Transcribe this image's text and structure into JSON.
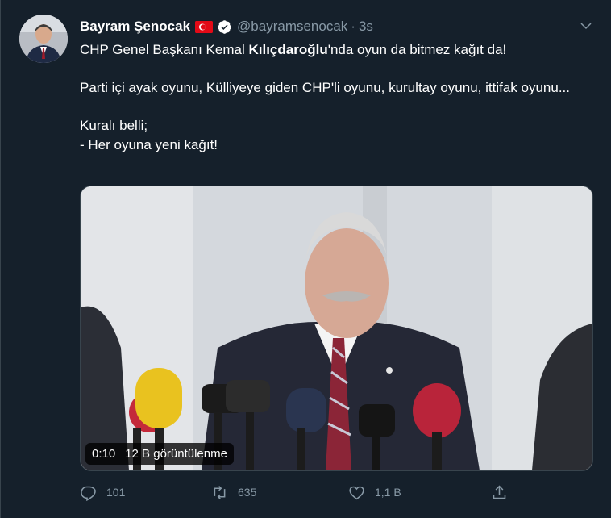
{
  "author": {
    "name": "Bayram Şenocak",
    "handle": "@bayramsenocak",
    "time": "3s"
  },
  "tweet": {
    "line1_pre": "CHP Genel Başkanı Kemal ",
    "line1_bold": "Kılıçdaroğlu",
    "line1_post": "'nda oyun da bitmez kağıt da!",
    "para2": "Parti içi ayak oyunu, Külliyeye giden CHP'li oyunu, kurultay oyunu, ittifak oyunu...",
    "para3_line1": "Kuralı belli;",
    "para3_line2": "- Her oyuna yeni kağıt!"
  },
  "media": {
    "duration": "0:10",
    "views": "12 B görüntülenme"
  },
  "actions": {
    "replies": "101",
    "retweets": "635",
    "likes": "1,1 B"
  },
  "colors": {
    "background": "#15202b",
    "secondary_text": "#8899a6",
    "border": "#38444d"
  }
}
